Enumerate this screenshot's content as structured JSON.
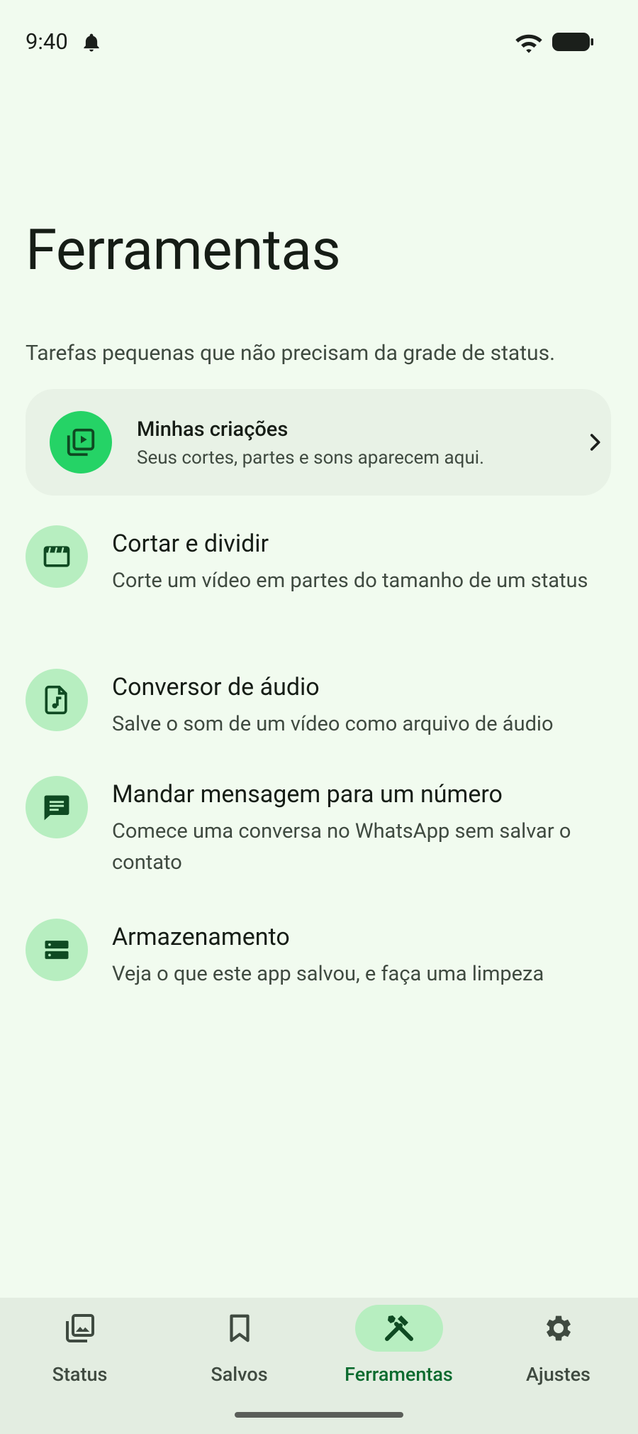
{
  "status_bar": {
    "time": "9:40"
  },
  "page": {
    "title": "Ferramentas",
    "subtitle": "Tarefas pequenas que não precisam da grade de status."
  },
  "featured": {
    "title": "Minhas criações",
    "subtitle": "Seus cortes, partes e sons aparecem aqui.",
    "icon": "video-library-icon"
  },
  "tools": [
    {
      "title": "Cortar e dividir",
      "subtitle": "Corte um vídeo em partes do tamanho de um status",
      "icon": "clapperboard-icon"
    },
    {
      "title": "Conversor de áudio",
      "subtitle": "Salve o som de um vídeo como arquivo de áudio",
      "icon": "audio-file-icon"
    },
    {
      "title": "Mandar mensagem para um número",
      "subtitle": "Comece uma conversa no WhatsApp sem salvar o contato",
      "icon": "message-icon"
    },
    {
      "title": "Armazenamento",
      "subtitle": "Veja o que este app salvou, e faça uma limpeza",
      "icon": "storage-icon"
    }
  ],
  "nav": {
    "items": [
      {
        "label": "Status",
        "icon": "gallery-icon"
      },
      {
        "label": "Salvos",
        "icon": "bookmark-icon"
      },
      {
        "label": "Ferramentas",
        "icon": "tools-icon",
        "active": true
      },
      {
        "label": "Ajustes",
        "icon": "gear-icon"
      }
    ]
  },
  "colors": {
    "background": "#f1fbef",
    "accent": "#25d366",
    "icon_circle": "#b7eec0",
    "active_label": "#0b6b2e"
  }
}
